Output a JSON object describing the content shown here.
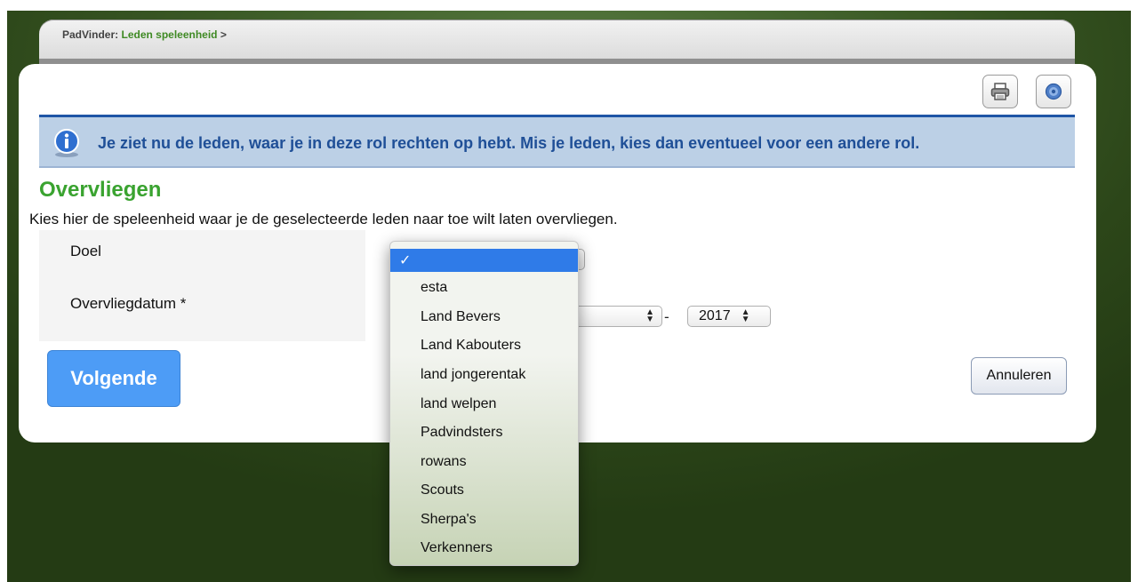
{
  "breadcrumb": {
    "root": "PadVinder:",
    "current": "Leden speleenheid",
    "separator": ">"
  },
  "toolbar": {
    "print_icon": "printer-icon",
    "help_icon": "help-icon"
  },
  "info": {
    "icon": "info-icon",
    "message": "Je ziet nu de leden, waar je in deze rol rechten op hebt. Mis je leden, kies dan eventueel voor een andere rol."
  },
  "section": {
    "title": "Overvliegen",
    "description": "Kies hier de speleenheid waar je de geselecteerde leden naar toe wilt laten overvliegen."
  },
  "form": {
    "doel_label": "Doel",
    "datum_label": "Overvliegdatum",
    "required_marker": "*",
    "date_separator": "-",
    "year_value": "2017"
  },
  "dropdown": {
    "selected_mark": "✓",
    "options": [
      "",
      "esta",
      "Land Bevers",
      "Land Kabouters",
      "land jongerentak",
      "land welpen",
      "Padvindsters",
      "rowans",
      "Scouts",
      "Sherpa's",
      "Verkenners"
    ]
  },
  "buttons": {
    "next": "Volgende",
    "cancel": "Annuleren"
  },
  "colors": {
    "accent_green": "#3aa330",
    "info_blue": "#1f4f97",
    "button_blue": "#4d9cf6",
    "selection_blue": "#2f7be8"
  }
}
